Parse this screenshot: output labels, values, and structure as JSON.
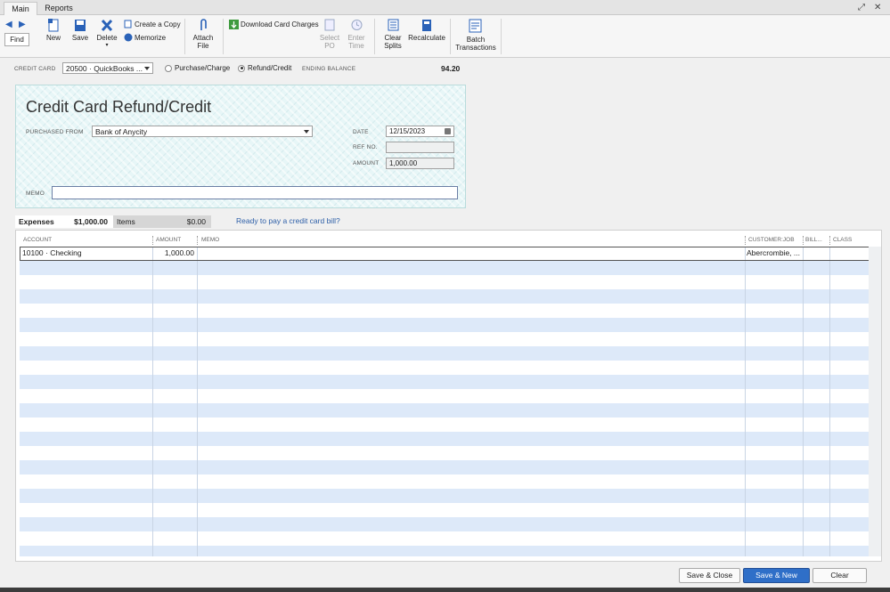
{
  "tabs": {
    "main": "Main",
    "reports": "Reports"
  },
  "toolbar": {
    "find": "Find",
    "new": "New",
    "save": "Save",
    "delete": "Delete",
    "create_copy": "Create a Copy",
    "memorize": "Memorize",
    "attach_file_1": "Attach",
    "attach_file_2": "File",
    "download_card_charges": "Download Card Charges",
    "select_po_1": "Select",
    "select_po_2": "PO",
    "enter_time_1": "Enter",
    "enter_time_2": "Time",
    "clear_splits_1": "Clear",
    "clear_splits_2": "Splits",
    "recalculate": "Recalculate",
    "batch_1": "Batch",
    "batch_2": "Transactions"
  },
  "header": {
    "credit_card_label": "CREDIT CARD",
    "credit_card_value": "20500 · QuickBooks ...",
    "purchase_charge": "Purchase/Charge",
    "refund_credit": "Refund/Credit",
    "ending_balance_label": "ENDING BALANCE",
    "ending_balance_value": "94.20"
  },
  "form": {
    "title": "Credit Card Refund/Credit",
    "purchased_from_label": "PURCHASED FROM",
    "purchased_from_value": "Bank of Anycity",
    "date_label": "DATE",
    "date_value": "12/15/2023",
    "ref_label": "REF NO.",
    "ref_value": "",
    "amount_label": "AMOUNT",
    "amount_value": "1,000.00",
    "memo_label": "MEMO",
    "memo_value": ""
  },
  "subtabs": {
    "expenses_label": "Expenses",
    "expenses_amount": "$1,000.00",
    "items_label": "Items",
    "items_amount": "$0.00",
    "pay_link": "Ready to pay a credit card bill?"
  },
  "grid": {
    "columns": [
      "ACCOUNT",
      "AMOUNT",
      "MEMO",
      "CUSTOMER:JOB",
      "BILL...",
      "CLASS"
    ],
    "rows": [
      {
        "account": "10100 · Checking",
        "amount": "1,000.00",
        "memo": "",
        "customer": "Abercrombie, ...",
        "billable": "",
        "class": ""
      }
    ]
  },
  "buttons": {
    "save_close": "Save & Close",
    "save_new": "Save & New",
    "clear": "Clear"
  },
  "colors": {
    "accent": "#2f6fc8",
    "row_alt": "#dde9f9",
    "check_bg": "#e7f6f7"
  }
}
